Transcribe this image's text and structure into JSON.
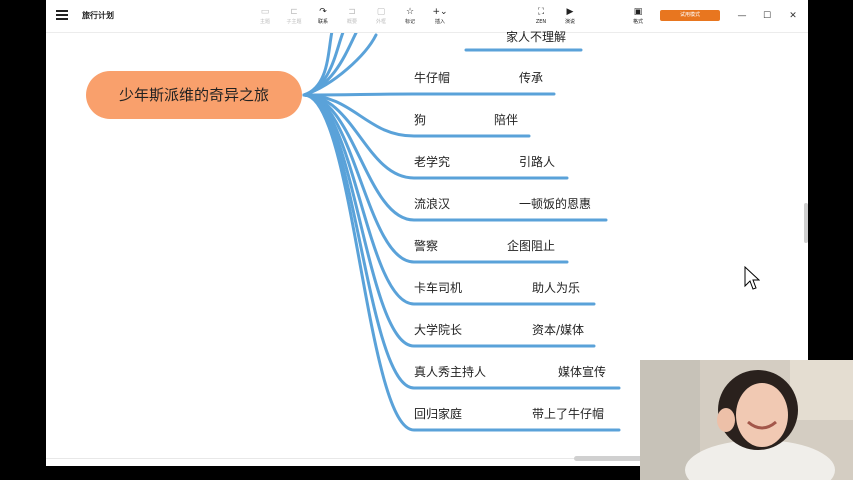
{
  "app": {
    "title": "旅行计划"
  },
  "toolbar": {
    "items": [
      {
        "label": "主题",
        "icon": "topic-icon",
        "enabled": false
      },
      {
        "label": "子主题",
        "icon": "subtopic-icon",
        "enabled": false
      },
      {
        "label": "联系",
        "icon": "relationship-icon",
        "enabled": true
      },
      {
        "label": "概要",
        "icon": "summary-icon",
        "enabled": false
      },
      {
        "label": "外框",
        "icon": "boundary-icon",
        "enabled": false
      },
      {
        "label": "标记",
        "icon": "star-marker-icon",
        "enabled": true
      },
      {
        "label": "插入",
        "icon": "insert-plus-icon",
        "enabled": true
      }
    ],
    "zen_label": "ZEN",
    "present_label": "演说",
    "format_label": "格式",
    "trial_label": "试用模式"
  },
  "mindmap": {
    "root": "少年斯派维的奇异之旅",
    "branch_color": "#5aa2d9",
    "root_color": "#f9a06c",
    "partial_top": "家人不理解",
    "nodes": [
      {
        "name": "牛仔帽",
        "role": "传承"
      },
      {
        "name": "狗",
        "role": "陪伴"
      },
      {
        "name": "老学究",
        "role": "引路人"
      },
      {
        "name": "流浪汉",
        "role": "一顿饭的恩惠"
      },
      {
        "name": "警察",
        "role": "企图阻止"
      },
      {
        "name": "卡车司机",
        "role": "助人为乐"
      },
      {
        "name": "大学院长",
        "role": "资本/媒体"
      },
      {
        "name": "真人秀主持人",
        "role": "媒体宣传"
      },
      {
        "name": "回归家庭",
        "role": "带上了牛仔帽"
      }
    ]
  }
}
